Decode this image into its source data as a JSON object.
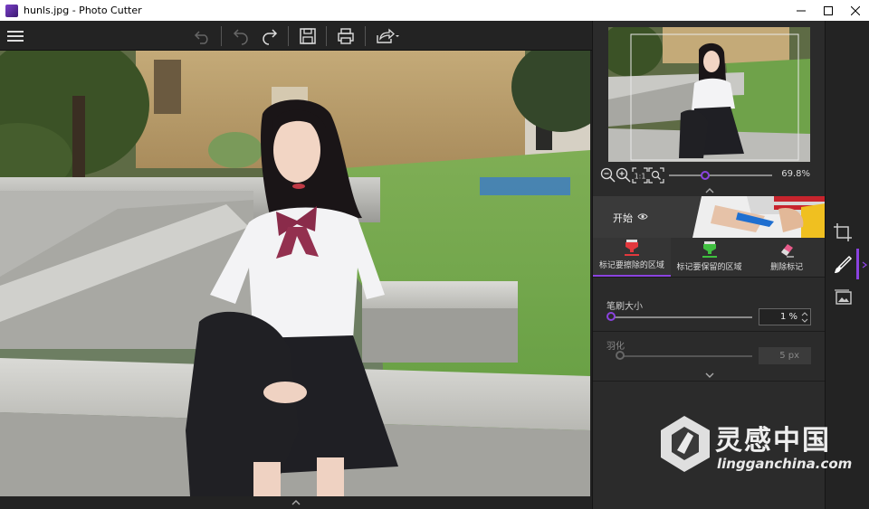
{
  "window": {
    "title": "hunls.jpg - Photo Cutter"
  },
  "toolbar": {
    "menu_icon": "hamburger-icon",
    "buttons": [
      "undo-all-icon",
      "undo-icon",
      "redo-icon",
      "save-icon",
      "print-icon",
      "share-icon"
    ]
  },
  "navigator": {
    "zoom_value": "69.8%"
  },
  "start": {
    "label": "开始"
  },
  "tabs": [
    {
      "label": "标记要擦除的区域",
      "active": true,
      "color": "#e2383d"
    },
    {
      "label": "标记要保留的区域",
      "active": false,
      "color": "#3fbf3f"
    },
    {
      "label": "删除标记",
      "active": false,
      "color": "#e85a8a"
    }
  ],
  "brush": {
    "label": "笔刷大小",
    "value": "1 %",
    "level": 0.01
  },
  "feather": {
    "label": "羽化",
    "value": "5 px",
    "level": 0
  },
  "side_tools": [
    "crop-icon",
    "brush-icon",
    "image-icon"
  ],
  "watermark": {
    "cn": "灵感中国",
    "en": "lingganchina.com"
  },
  "colors": {
    "accent": "#8b43e0"
  }
}
